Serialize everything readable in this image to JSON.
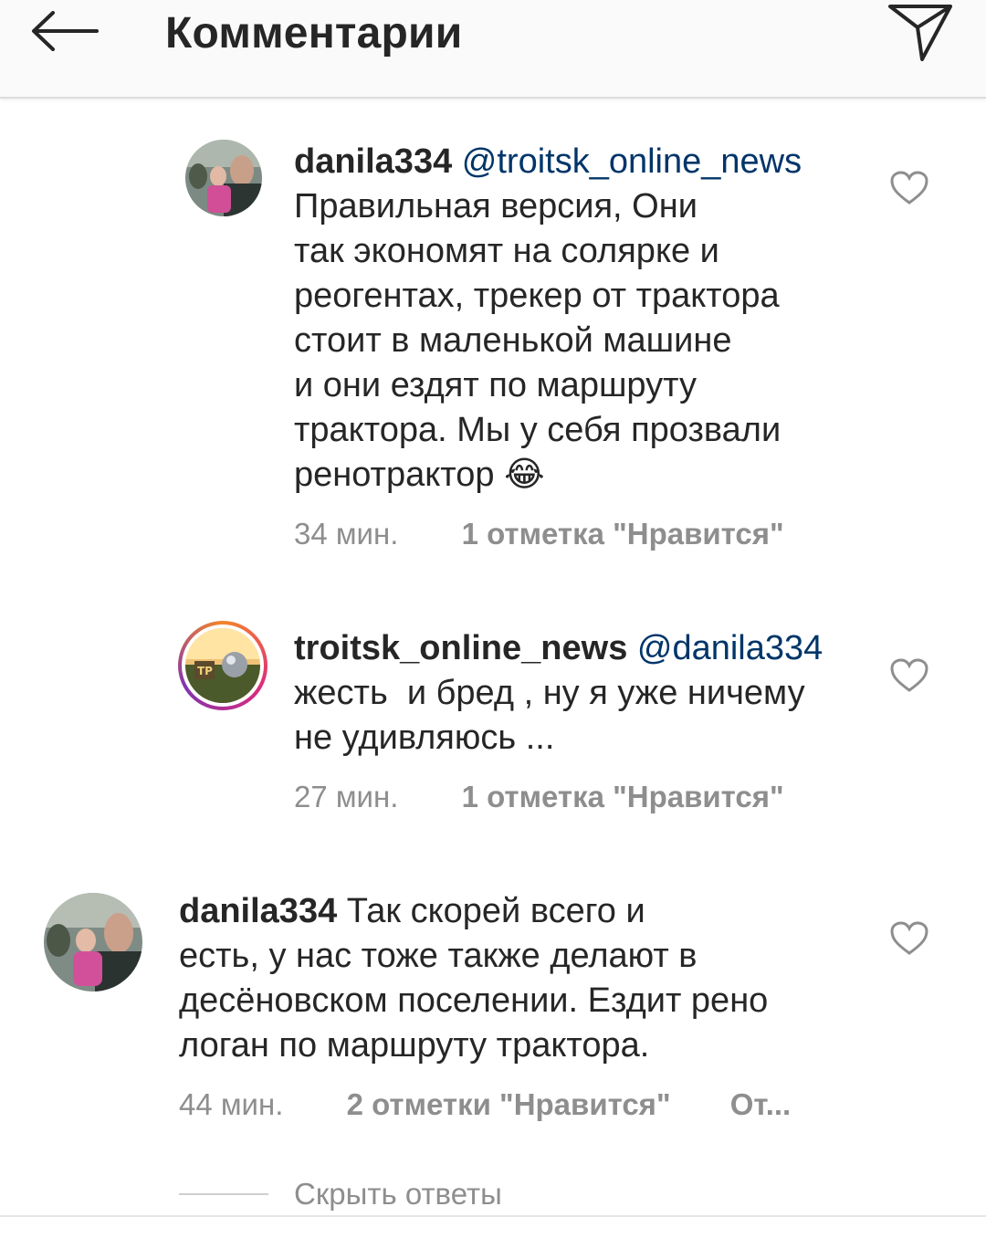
{
  "header": {
    "title": "Комментарии",
    "back_icon": "arrow-left-icon",
    "direct_icon": "paper-plane-icon"
  },
  "comments": [
    {
      "username": "danila334",
      "mention": "@troitsk_online_news",
      "lines": [
        "Правильная версия, Они",
        "так экономят на солярке и",
        "реогентах, трекер от трактора",
        "стоит в маленькой машине",
        "и они ездят по маршруту",
        "трактора. Мы у себя прозвали",
        "ренотрактор 😂"
      ],
      "time": "34 мин.",
      "likes": "1 отметка \"Нравится\"",
      "reply": ""
    },
    {
      "username": "troitsk_online_news",
      "mention": "@danila334",
      "lines": [
        "жесть  и бред , ну я уже ничему",
        "не удивляюсь ..."
      ],
      "time": "27 мин.",
      "likes": "1 отметка \"Нравится\"",
      "reply": ""
    },
    {
      "username": "danila334",
      "first_line_text": "Так скорей всего и",
      "lines": [
        "есть, у нас тоже также делают в",
        "десёновском поселении. Ездит рено",
        "логан по маршруту трактора."
      ],
      "time": "44 мин.",
      "likes": "2 отметки \"Нравится\"",
      "reply": "От..."
    }
  ],
  "hide_replies_label": "Скрыть ответы",
  "colors": {
    "text": "#262626",
    "mention": "#003569",
    "muted": "#8e8e8e",
    "header_bg": "#fafafa"
  }
}
